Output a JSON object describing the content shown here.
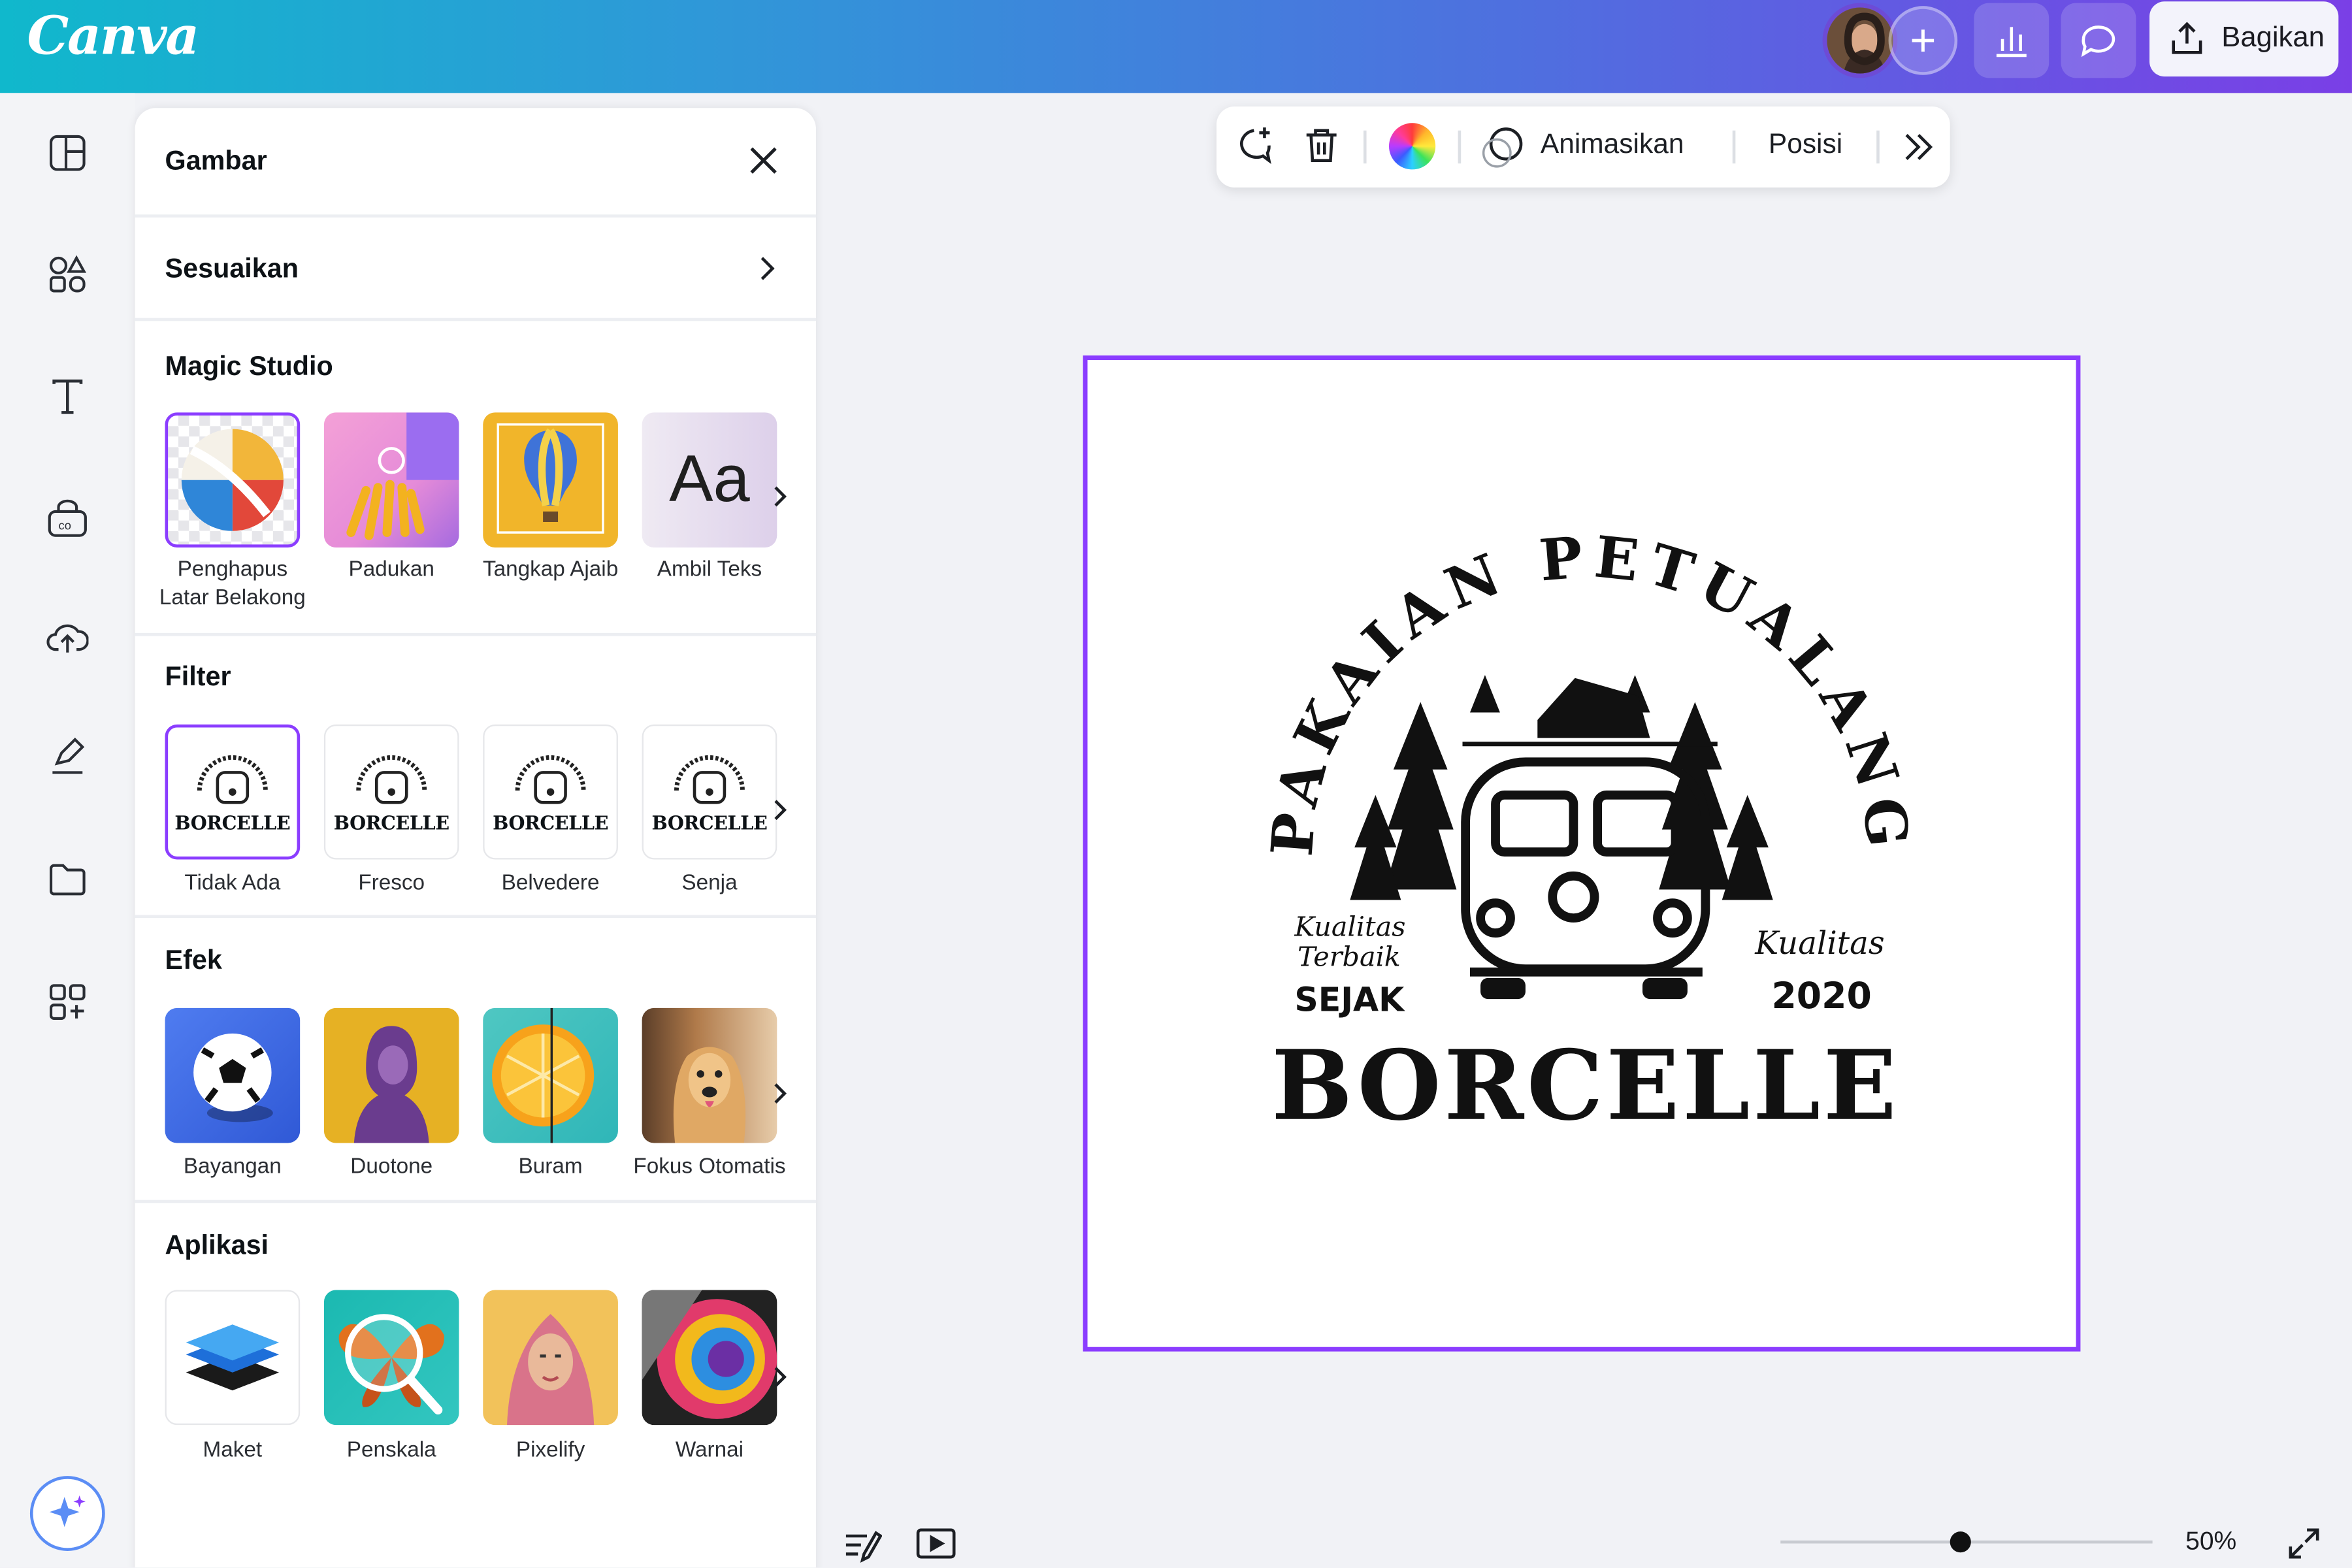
{
  "header": {
    "logo": "Canva",
    "share_label": "Bagikan"
  },
  "panel": {
    "title": "Gambar",
    "adjust_label": "Sesuaikan",
    "sections": {
      "magic": {
        "title": "Magic Studio",
        "items": [
          "Penghapus\nLatar Belakong",
          "Padukan",
          "Tangkap Ajaib",
          "Ambil Teks"
        ]
      },
      "filter": {
        "title": "Filter",
        "items": [
          "Tidak Ada",
          "Fresco",
          "Belvedere",
          "Senja"
        ]
      },
      "effects": {
        "title": "Efek",
        "items": [
          "Bayangan",
          "Duotone",
          "Buram",
          "Fokus Otomatis"
        ]
      },
      "apps": {
        "title": "Aplikasi",
        "items": [
          "Maket",
          "Penskala",
          "Pixelify",
          "Warnai"
        ]
      }
    }
  },
  "toolbar": {
    "animate_label": "Animasikan",
    "position_label": "Posisi"
  },
  "design": {
    "arc_text": "PAKAIAN PETUALANG",
    "left_small": "Kualitas",
    "left_small2": "Terbaik",
    "left_big": "SEJAK",
    "right_small": "Kualitas",
    "right_big": "2020",
    "brand": "BORCELLE"
  },
  "thumb_text": {
    "brand": "BORCELLE",
    "arc": "ADVENTURE CLOTHING",
    "aa": "Aa"
  },
  "zoom": {
    "value": "50%"
  },
  "colors": {
    "accent": "#8b3dff"
  }
}
